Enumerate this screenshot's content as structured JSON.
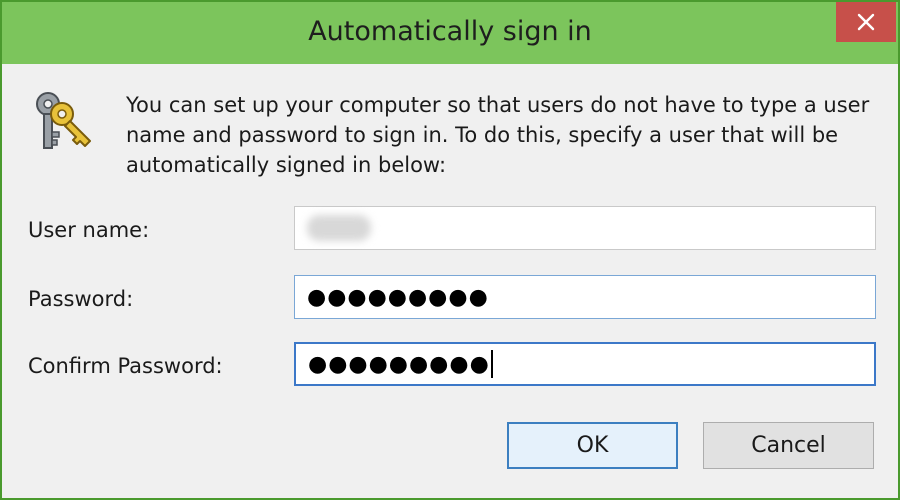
{
  "window": {
    "title": "Automatically sign in",
    "close_label": "✕"
  },
  "description": "You can set up your computer so that users do not have to type a user name and password to sign in. To do this, specify a user that will be automatically signed in below:",
  "icon": "keys-icon",
  "fields": {
    "user_name": {
      "label": "User name:",
      "value": ""
    },
    "password": {
      "label": "Password:",
      "value": "●●●●●●●●●"
    },
    "confirm_password": {
      "label": "Confirm Password:",
      "value": "●●●●●●●●●"
    }
  },
  "buttons": {
    "ok": "OK",
    "cancel": "Cancel"
  },
  "colors": {
    "titlebar": "#7cc55c",
    "border": "#4a9a2e",
    "close": "#c7504a",
    "focus": "#3c78c8"
  }
}
